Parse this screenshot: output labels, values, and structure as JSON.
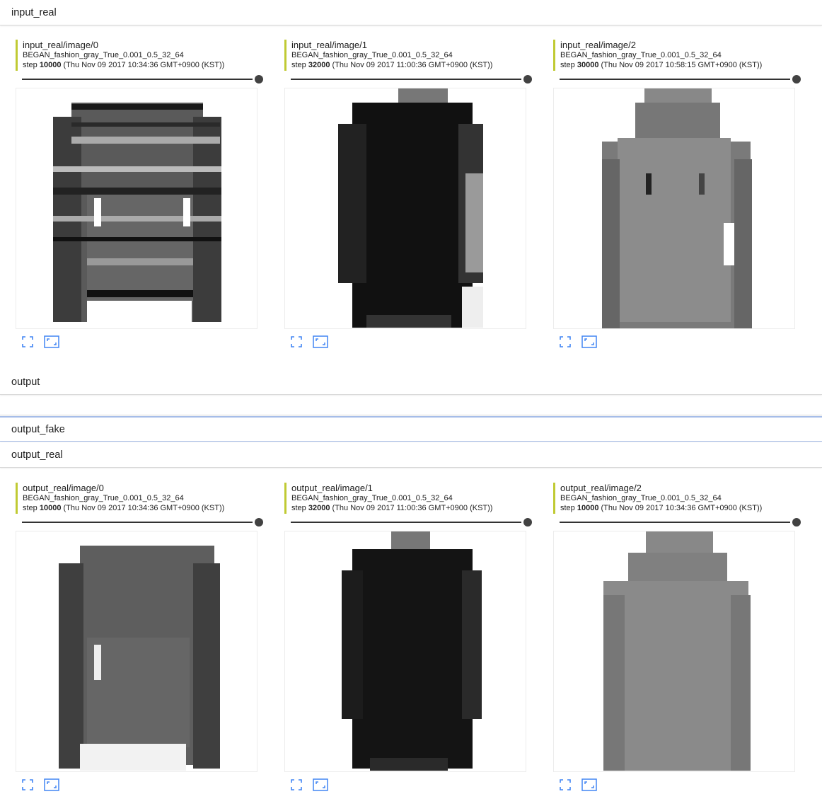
{
  "sections": [
    {
      "name": "input_real"
    },
    {
      "name": "output"
    },
    {
      "name": "output_fake"
    },
    {
      "name": "output_real"
    }
  ],
  "icons": {
    "fullscreen": "fullscreen-icon",
    "actual_size": "actual-size-icon"
  },
  "colors": {
    "run_accent": "#c0ca33",
    "icon_blue": "#4285f4"
  },
  "input_real_cards": [
    {
      "tag": "input_real/image/0",
      "run": "BEGAN_fashion_gray_True_0.001_0.5_32_64",
      "step_value": "10000",
      "step_time": "(Thu Nov 09 2017 10:34:36 GMT+0900 (KST))",
      "step_prefix": "step",
      "garment": "striped-sweater"
    },
    {
      "tag": "input_real/image/1",
      "run": "BEGAN_fashion_gray_True_0.001_0.5_32_64",
      "step_value": "32000",
      "step_time": "(Thu Nov 09 2017 11:00:36 GMT+0900 (KST))",
      "step_prefix": "step",
      "garment": "dark-coat"
    },
    {
      "tag": "input_real/image/2",
      "run": "BEGAN_fashion_gray_True_0.001_0.5_32_64",
      "step_value": "30000",
      "step_time": "(Thu Nov 09 2017 10:58:15 GMT+0900 (KST))",
      "step_prefix": "step",
      "garment": "gray-hoodie"
    }
  ],
  "output_real_cards": [
    {
      "tag": "output_real/image/0",
      "run": "BEGAN_fashion_gray_True_0.001_0.5_32_64",
      "step_value": "10000",
      "step_time": "(Thu Nov 09 2017 10:34:36 GMT+0900 (KST))",
      "step_prefix": "step",
      "garment": "dark-sweater-blurry"
    },
    {
      "tag": "output_real/image/1",
      "run": "BEGAN_fashion_gray_True_0.001_0.5_32_64",
      "step_value": "32000",
      "step_time": "(Thu Nov 09 2017 11:00:36 GMT+0900 (KST))",
      "step_prefix": "step",
      "garment": "dark-coat-blurry"
    },
    {
      "tag": "output_real/image/2",
      "run": "BEGAN_fashion_gray_True_0.001_0.5_32_64",
      "step_value": "10000",
      "step_time": "(Thu Nov 09 2017 10:34:36 GMT+0900 (KST))",
      "step_prefix": "step",
      "garment": "gray-hoodie-blurry"
    }
  ]
}
